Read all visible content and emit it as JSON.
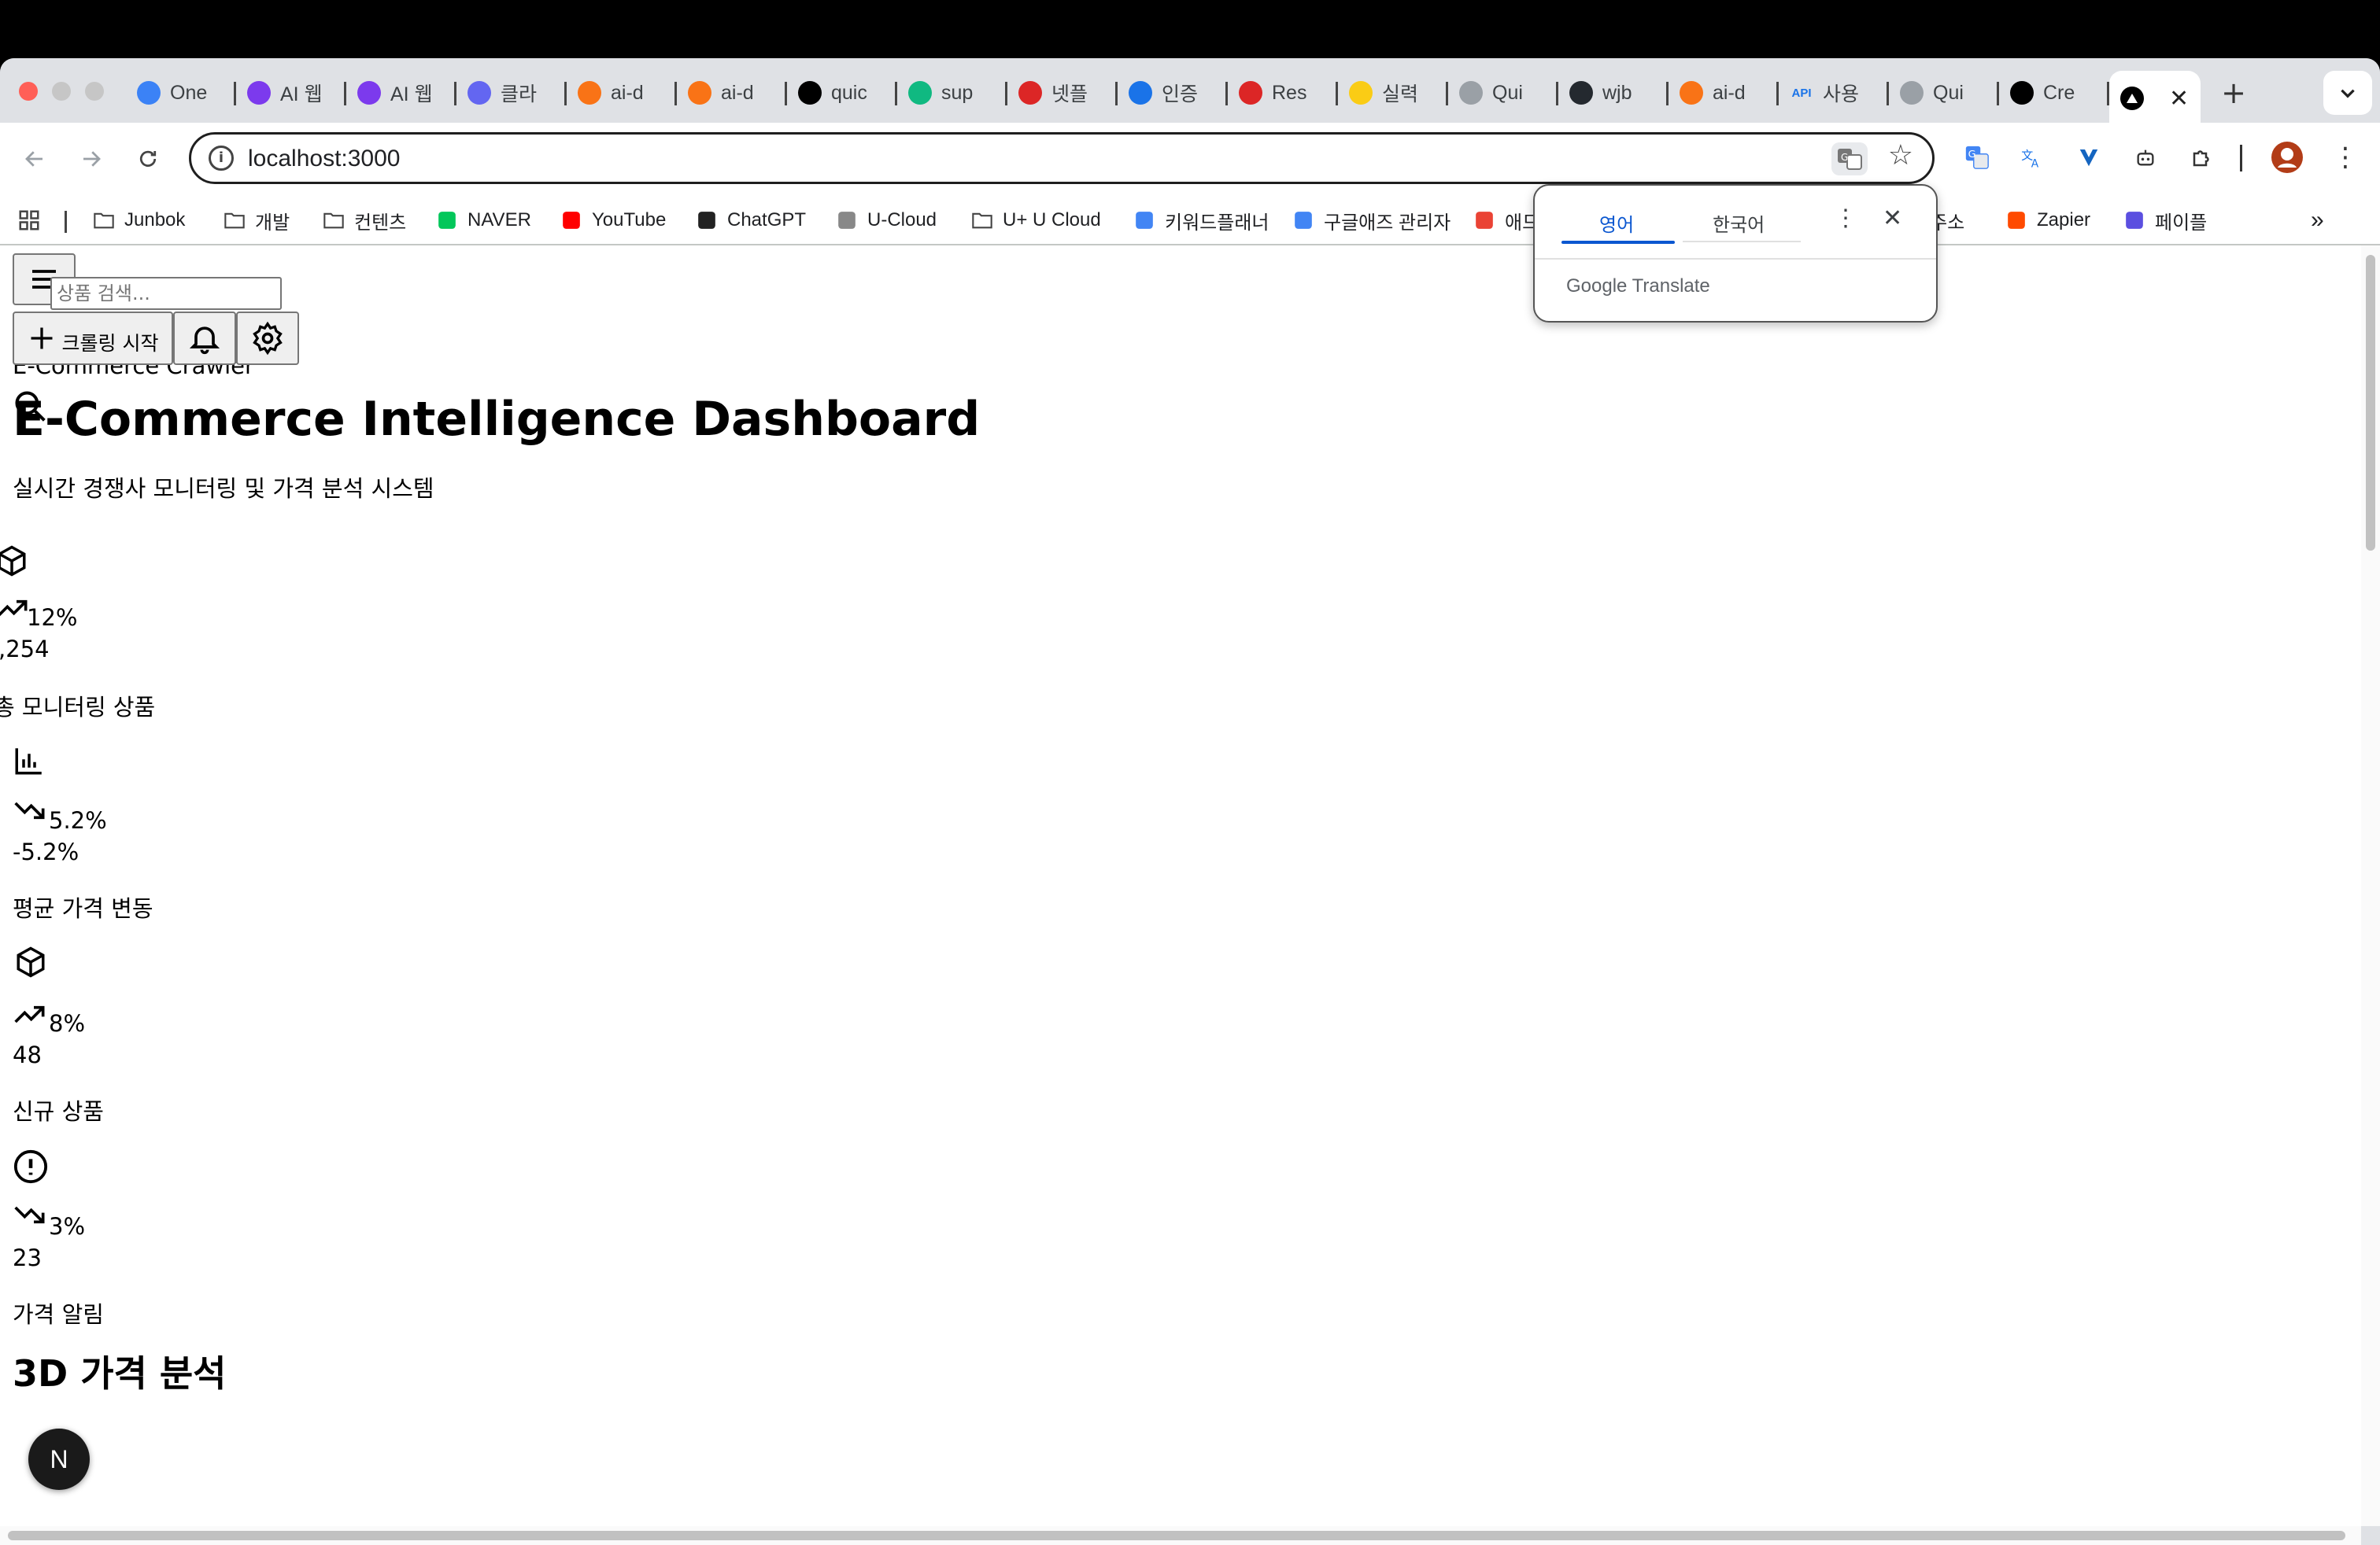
{
  "browser": {
    "tabs": [
      {
        "label": "One",
        "icon": "gem-icon",
        "color": "#3b82f6"
      },
      {
        "label": "AI 웹",
        "icon": "app-icon",
        "color": "#7c3aed"
      },
      {
        "label": "AI 웹",
        "icon": "app-icon",
        "color": "#7c3aed"
      },
      {
        "label": "클라",
        "icon": "shield-icon",
        "color": "#6366f1"
      },
      {
        "label": "ai-d",
        "icon": "flame-icon",
        "color": "#f97316"
      },
      {
        "label": "ai-d",
        "icon": "flame-icon",
        "color": "#f97316"
      },
      {
        "label": "quic",
        "icon": "triangle-icon",
        "color": "#000000"
      },
      {
        "label": "sup",
        "icon": "bolt-icon",
        "color": "#10b981"
      },
      {
        "label": "넷플",
        "icon": "n-icon",
        "color": "#dc2626"
      },
      {
        "label": "인증",
        "icon": "globe-icon",
        "color": "#1a73e8"
      },
      {
        "label": "Res",
        "icon": "n-icon",
        "color": "#dc2626"
      },
      {
        "label": "실력",
        "icon": "smile-icon",
        "color": "#facc15"
      },
      {
        "label": "Qui",
        "icon": "globe-icon",
        "color": "#9aa0a6"
      },
      {
        "label": "wjb",
        "icon": "github-icon",
        "color": "#24292f"
      },
      {
        "label": "ai-d",
        "icon": "flame-icon",
        "color": "#f97316"
      },
      {
        "label": "사용",
        "icon": "api-icon",
        "color": "#1a73e8"
      },
      {
        "label": "Qui",
        "icon": "globe-icon",
        "color": "#9aa0a6"
      },
      {
        "label": "Cre",
        "icon": "triangle-icon",
        "color": "#000000"
      }
    ],
    "active_tab": {
      "label": "",
      "icon": "triangle-icon"
    },
    "api_badge": "API",
    "new_tab": "+",
    "close_glyph": "✕",
    "url": "localhost:3000",
    "bookmarks": [
      {
        "label": "Junbok",
        "icon": "folder-icon"
      },
      {
        "label": "개발",
        "icon": "folder-icon"
      },
      {
        "label": "컨텐츠",
        "icon": "folder-icon"
      },
      {
        "label": "NAVER",
        "icon": "naver-icon"
      },
      {
        "label": "YouTube",
        "icon": "youtube-icon"
      },
      {
        "label": "ChatGPT",
        "icon": "chatgpt-icon"
      },
      {
        "label": "U-Cloud",
        "icon": "ucloud-icon"
      },
      {
        "label": "U+ U Cloud",
        "icon": "cloud-icon"
      },
      {
        "label": "키워드플래너",
        "icon": "google-ads-icon"
      },
      {
        "label": "구글애즈 관리자",
        "icon": "google-ads-icon"
      },
      {
        "label": "애드",
        "icon": "circle-icon"
      },
      {
        "label": "링주소",
        "icon": ""
      },
      {
        "label": "Zapier",
        "icon": "zapier-icon"
      },
      {
        "label": "페이플",
        "icon": "payple-icon"
      }
    ],
    "bookmarks_more": "»"
  },
  "translate_popup": {
    "tab_source": "영어",
    "tab_target": "한국어",
    "brand_google": "Google",
    "brand_translate": "Translate"
  },
  "app": {
    "brand": "E-Commerce Crawler",
    "search_placeholder": "상품 검색...",
    "crawl_button": "크롤링 시작",
    "title": "E-Commerce Intelligence Dashboard",
    "subtitle": "실시간 경쟁사 모니터링 및 가격 분석 시스템",
    "stats": [
      {
        "icon": "package-icon",
        "trend_icon": "trending-up-icon",
        "change": "12%",
        "value": ",254",
        "label": "총 모니터링 상품"
      },
      {
        "icon": "bar-chart-icon",
        "trend_icon": "trending-down-icon",
        "change": "5.2%",
        "value": "-5.2%",
        "label": "평균 가격 변동"
      },
      {
        "icon": "package-icon",
        "trend_icon": "trending-up-icon",
        "change": "8%",
        "value": "48",
        "label": "신규 상품"
      },
      {
        "icon": "alert-circle-icon",
        "trend_icon": "trending-down-icon",
        "change": "3%",
        "value": "23",
        "label": "가격 알림"
      }
    ],
    "section_title": "3D 가격 분석"
  },
  "nextjs_badge": "N"
}
